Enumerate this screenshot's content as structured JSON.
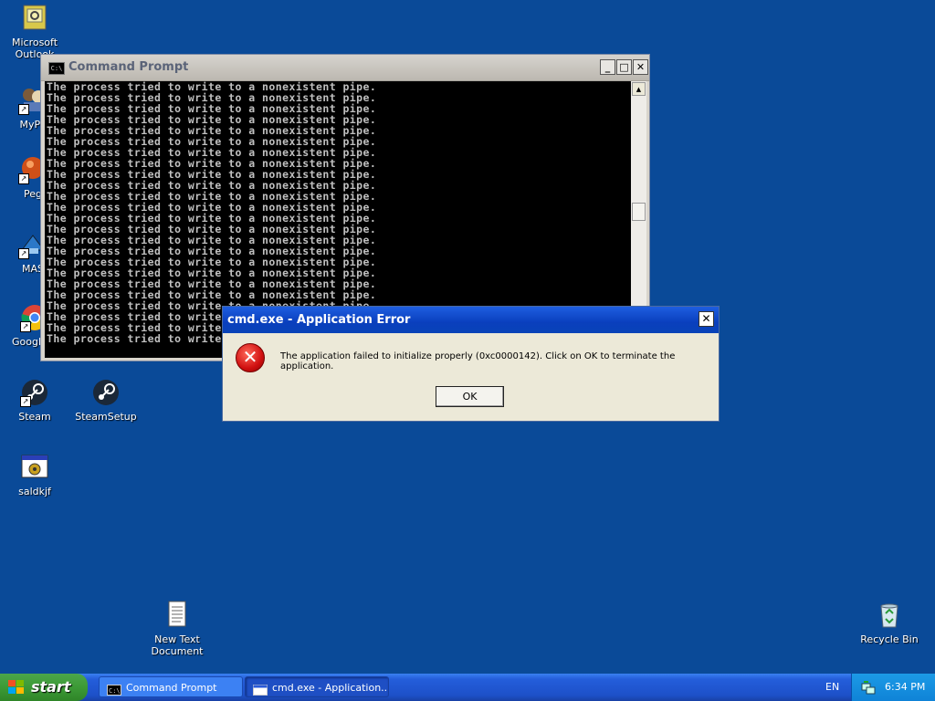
{
  "desktop": {
    "icons": [
      {
        "label": "Microsoft Outlook"
      },
      {
        "label": "MyPa"
      },
      {
        "label": "Peg"
      },
      {
        "label": "MAS"
      },
      {
        "label": "Google C"
      },
      {
        "label": "Steam"
      },
      {
        "label": "SteamSetup"
      },
      {
        "label": "saldkjf"
      },
      {
        "label": "New Text Document"
      },
      {
        "label": "Recycle Bin"
      }
    ]
  },
  "cmd_window": {
    "title": "Command Prompt",
    "icon_text": "C:\\",
    "lines": [
      "The process tried to write to a nonexistent pipe.",
      "The process tried to write to a nonexistent pipe.",
      "The process tried to write to a nonexistent pipe.",
      "The process tried to write to a nonexistent pipe.",
      "The process tried to write to a nonexistent pipe.",
      "The process tried to write to a nonexistent pipe.",
      "The process tried to write to a nonexistent pipe.",
      "The process tried to write to a nonexistent pipe.",
      "The process tried to write to a nonexistent pipe.",
      "The process tried to write to a nonexistent pipe.",
      "The process tried to write to a nonexistent pipe.",
      "The process tried to write to a nonexistent pipe.",
      "The process tried to write to a nonexistent pipe.",
      "The process tried to write to a nonexistent pipe.",
      "The process tried to write to a nonexistent pipe.",
      "The process tried to write to a nonexistent pipe.",
      "The process tried to write to a nonexistent pipe.",
      "The process tried to write to a nonexistent pipe.",
      "The process tried to write to a nonexistent pipe.",
      "The process tried to write to a nonexistent pipe.",
      "The process tried to write to a nonexistent pipe.",
      "The process tried to write to a nonexistent pipe.",
      "The process tried to write to a nonexistent pipe.",
      "The process tried to write to a nonexistent pipe."
    ],
    "buttons": {
      "minimize": "_",
      "maximize": "□",
      "close": "✕"
    },
    "scroll_up": "▲"
  },
  "error_dialog": {
    "title": "cmd.exe - Application Error",
    "close_glyph": "✕",
    "icon_glyph": "✕",
    "message": "The application failed to initialize properly (0xc0000142). Click on OK to terminate the application.",
    "ok_label": "OK"
  },
  "taskbar": {
    "start_label": "start",
    "tasks": [
      {
        "label": "Command Prompt",
        "icon": "cmd-icon"
      },
      {
        "label": "cmd.exe - Application...",
        "icon": "window-icon"
      }
    ],
    "language": "EN",
    "clock": "6:34 PM"
  },
  "colors": {
    "desktop": "#0a4a98",
    "dialog_title": "#0a3fbd",
    "taskbar": "#245edb",
    "start": "#3c9a36"
  }
}
